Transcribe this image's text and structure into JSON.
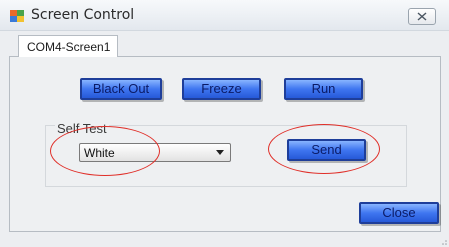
{
  "window": {
    "title": "Screen Control"
  },
  "tabs": [
    {
      "label": "COM4-Screen1"
    }
  ],
  "controls": {
    "blackout_label": "Black Out",
    "freeze_label": "Freeze",
    "run_label": "Run"
  },
  "self_test": {
    "group_label": "Self Test",
    "selected_value": "White",
    "send_label": "Send"
  },
  "footer": {
    "close_label": "Close"
  },
  "colors": {
    "button_fill": "#3f76f0",
    "button_border": "#1e3e9a",
    "annotation_ellipse": "#e0302a"
  }
}
